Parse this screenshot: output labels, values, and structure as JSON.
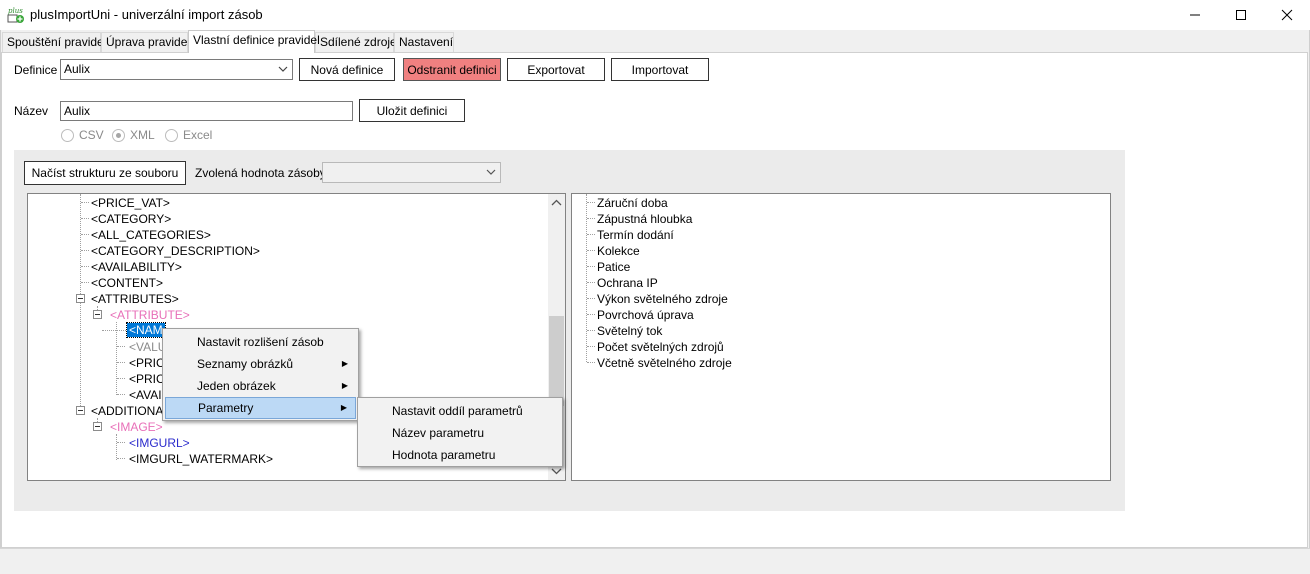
{
  "window": {
    "title": "plusImportUni - univerzální import zásob",
    "icon_text": "plus"
  },
  "tabs": [
    {
      "label": "Spouštění pravidel"
    },
    {
      "label": "Úprava pravidel"
    },
    {
      "label": "Vlastní definice pravidel"
    },
    {
      "label": "Sdílené zdroje"
    },
    {
      "label": "Nastavení"
    }
  ],
  "definition": {
    "label": "Definice",
    "selected": "Aulix",
    "new_button": "Nová definice",
    "delete_button": "Odstranit definici",
    "export_button": "Exportovat",
    "import_button": "Importovat"
  },
  "name": {
    "label": "Název",
    "value": "Aulix",
    "save_button": "Uložit definici"
  },
  "format": {
    "options": [
      "CSV",
      "XML",
      "Excel"
    ],
    "selected": "XML"
  },
  "structure": {
    "load_button": "Načíst strukturu ze souboru",
    "stock_label": "Zvolená hodnota zásoby",
    "stock_value": ""
  },
  "tree": [
    {
      "text": "<PRICE_VAT>",
      "color": "#000000"
    },
    {
      "text": "<CATEGORY>",
      "color": "#000000"
    },
    {
      "text": "<ALL_CATEGORIES>",
      "color": "#000000"
    },
    {
      "text": "<CATEGORY_DESCRIPTION>",
      "color": "#000000"
    },
    {
      "text": "<AVAILABILITY>",
      "color": "#000000"
    },
    {
      "text": "<CONTENT>",
      "color": "#000000"
    },
    {
      "text": "<ATTRIBUTES>",
      "color": "#000000"
    },
    {
      "text": "<ATTRIBUTE>",
      "color": "#e86fb8"
    },
    {
      "text": "<NAME>",
      "color": "#ffffff",
      "selected": true
    },
    {
      "text": "<VALUE>",
      "color": "#8a8a8a"
    },
    {
      "text": "<PRICE>",
      "color": "#000000"
    },
    {
      "text": "<PRICE>",
      "color": "#000000"
    },
    {
      "text": "<AVAIL>",
      "color": "#000000"
    },
    {
      "text": "<ADDITIONAL>",
      "color": "#000000"
    },
    {
      "text": "<IMAGE>",
      "color": "#e86fb8"
    },
    {
      "text": "<IMGURL>",
      "color": "#2b2bcc"
    },
    {
      "text": "<IMGURL_WATERMARK>",
      "color": "#000000"
    }
  ],
  "tree_visible_text": {
    "name": "<NAM",
    "value": "<VALU",
    "price1": "<PRIC",
    "price2": "<PRIC",
    "avail": "<AVAI",
    "additional": "<ADDITIONAL"
  },
  "params": [
    "Záruční doba",
    "Zápustná hloubka",
    "Termín dodání",
    "Kolekce",
    "Patice",
    "Ochrana IP",
    "Výkon světelného zdroje",
    "Povrchová úprava",
    "Světelný tok",
    "Počet světelných zdrojů",
    "Včetně světelného zdroje"
  ],
  "context_menu": {
    "items": [
      {
        "label": "Nastavit rozlišení zásob",
        "submenu": false
      },
      {
        "label": "Seznamy obrázků",
        "submenu": true
      },
      {
        "label": "Jeden obrázek",
        "submenu": true
      },
      {
        "label": "Parametry",
        "submenu": true,
        "highlighted": true
      }
    ],
    "submenu": [
      {
        "label": "Nastavit oddíl parametrů"
      },
      {
        "label": "Název parametru"
      },
      {
        "label": "Hodnota parametru"
      }
    ]
  },
  "colors": {
    "delete_button_bg": "#f08080",
    "selection_bg": "#0078d7",
    "attribute_node": "#e86fb8",
    "imgurl_node": "#2b2bcc"
  }
}
